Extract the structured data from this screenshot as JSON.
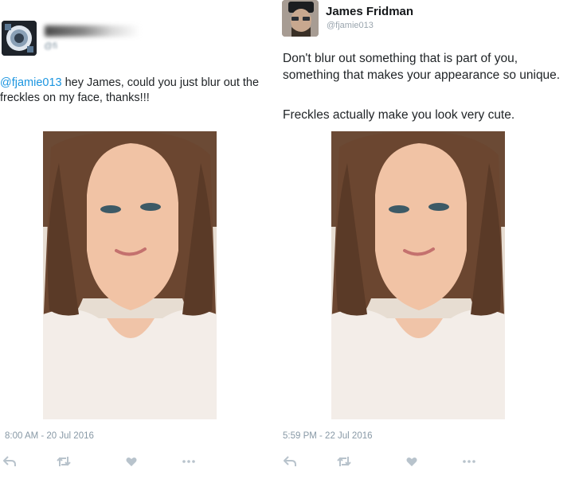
{
  "left_tweet": {
    "handle_blurred": "@fi",
    "mention": "@fjamie013",
    "text": " hey James, could you just blur out the freckles on my face, thanks!!!",
    "timestamp": "8:00 AM - 20 Jul 2016"
  },
  "right_tweet": {
    "name": "James Fridman",
    "handle": "@fjamie013",
    "text_line1": "Don't blur out something that is part of you, something that makes your appearance so unique.",
    "text_line2": "Freckles actually make you look very cute.",
    "timestamp": "5:59 PM - 22 Jul 2016"
  },
  "actions": [
    "reply-icon",
    "retweet-icon",
    "like-icon",
    "more-icon"
  ],
  "colors": {
    "link": "#1b95e0",
    "muted": "#8899a6",
    "action_icon": "#b8c3cc"
  }
}
